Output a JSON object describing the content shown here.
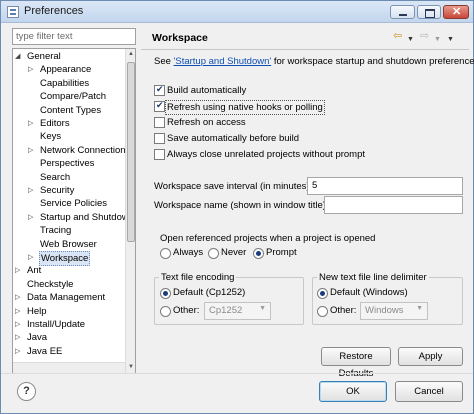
{
  "window": {
    "title": "Preferences"
  },
  "filter": {
    "placeholder": "type filter text"
  },
  "tree": [
    {
      "label": "General",
      "level": 0,
      "state": "expanded"
    },
    {
      "label": "Appearance",
      "level": 1,
      "state": "collapsed"
    },
    {
      "label": "Capabilities",
      "level": 1,
      "state": "leaf"
    },
    {
      "label": "Compare/Patch",
      "level": 1,
      "state": "leaf"
    },
    {
      "label": "Content Types",
      "level": 1,
      "state": "leaf"
    },
    {
      "label": "Editors",
      "level": 1,
      "state": "collapsed"
    },
    {
      "label": "Keys",
      "level": 1,
      "state": "leaf"
    },
    {
      "label": "Network Connection",
      "level": 1,
      "state": "collapsed"
    },
    {
      "label": "Perspectives",
      "level": 1,
      "state": "leaf"
    },
    {
      "label": "Search",
      "level": 1,
      "state": "leaf"
    },
    {
      "label": "Security",
      "level": 1,
      "state": "collapsed"
    },
    {
      "label": "Service Policies",
      "level": 1,
      "state": "leaf"
    },
    {
      "label": "Startup and Shutdown",
      "level": 1,
      "state": "collapsed"
    },
    {
      "label": "Tracing",
      "level": 1,
      "state": "leaf"
    },
    {
      "label": "Web Browser",
      "level": 1,
      "state": "leaf"
    },
    {
      "label": "Workspace",
      "level": 1,
      "state": "collapsed",
      "selected": true
    },
    {
      "label": "Ant",
      "level": 0,
      "state": "collapsed"
    },
    {
      "label": "Checkstyle",
      "level": 0,
      "state": "leaf"
    },
    {
      "label": "Data Management",
      "level": 0,
      "state": "collapsed"
    },
    {
      "label": "Help",
      "level": 0,
      "state": "collapsed"
    },
    {
      "label": "Install/Update",
      "level": 0,
      "state": "collapsed"
    },
    {
      "label": "Java",
      "level": 0,
      "state": "collapsed"
    },
    {
      "label": "Java EE",
      "level": 0,
      "state": "collapsed"
    }
  ],
  "page": {
    "title": "Workspace",
    "intro_prefix": "See ",
    "intro_link": "'Startup and Shutdown'",
    "intro_suffix": " for workspace startup and shutdown preferences.",
    "checkboxes": [
      {
        "label": "Build automatically",
        "checked": true
      },
      {
        "label": "Refresh using native hooks or polling",
        "checked": true,
        "focused": true
      },
      {
        "label": "Refresh on access",
        "checked": false
      },
      {
        "label": "Save automatically before build",
        "checked": false
      },
      {
        "label": "Always close unrelated projects without prompt",
        "checked": false
      }
    ],
    "save_interval": {
      "label": "Workspace save interval (in minutes):",
      "value": "5"
    },
    "workspace_name": {
      "label": "Workspace name (shown in window title):",
      "value": ""
    },
    "open_projects": {
      "title": "Open referenced projects when a project is opened",
      "options": [
        "Always",
        "Never",
        "Prompt"
      ],
      "selected": "Prompt"
    },
    "encoding": {
      "title": "Text file encoding",
      "default_label": "Default (Cp1252)",
      "other_label": "Other:",
      "other_value": "Cp1252",
      "selected": "default"
    },
    "line_delimiter": {
      "title": "New text file line delimiter",
      "default_label": "Default (Windows)",
      "other_label": "Other:",
      "other_value": "Windows",
      "selected": "default"
    },
    "restore_label": "Restore Defaults",
    "apply_label": "Apply"
  },
  "footer": {
    "help_label": "?",
    "ok_label": "OK",
    "cancel_label": "Cancel"
  },
  "icons": {
    "back": "back-arrow-icon",
    "forward": "forward-arrow-icon",
    "menu": "view-menu-icon",
    "help": "help-icon"
  },
  "colors": {
    "link": "#0b4fb3",
    "selection": "#d9e5f5",
    "title_bar": "#c3d6ee"
  }
}
